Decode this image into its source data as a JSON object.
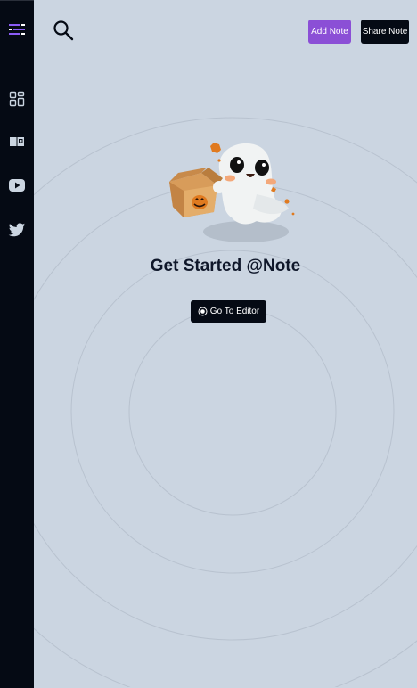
{
  "sidebar": {
    "items": [
      {
        "icon": "menu-icon"
      },
      {
        "icon": "dashboard-icon"
      },
      {
        "icon": "book-icon"
      },
      {
        "icon": "youtube-icon"
      },
      {
        "icon": "twitter-icon"
      }
    ]
  },
  "header": {
    "add_note_label": "Add Note",
    "share_note_label": "Share Note"
  },
  "main": {
    "title": "Get Started @Note",
    "editor_button_label": "Go To Editor"
  },
  "colors": {
    "background": "#cbd5e1",
    "sidebar": "#050a14",
    "accent": "#8b4fd6",
    "menu_icon_accent": "#8b5cf6"
  }
}
